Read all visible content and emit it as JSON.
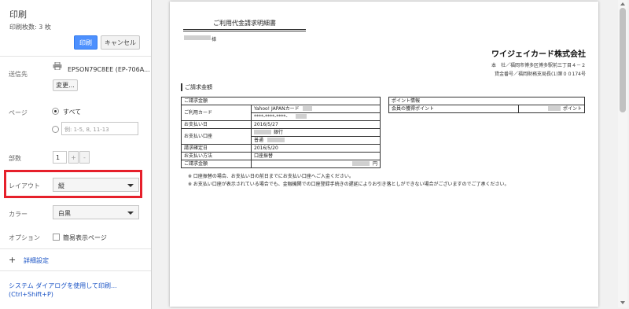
{
  "sidebar": {
    "title": "印刷",
    "sheets": "印刷枚数: 3 枚",
    "print_button": "印刷",
    "cancel_button": "キャンセル",
    "destination_label": "送信先",
    "printer_name": "EPSON79C8EE (EP-706A...",
    "change_button": "変更...",
    "pages_label": "ページ",
    "pages_all": "すべて",
    "pages_range_placeholder": "例: 1-5, 8, 11-13",
    "copies_label": "部数",
    "copies_value": "1",
    "copies_plus": "+",
    "copies_minus": "-",
    "layout_label": "レイアウト",
    "layout_value": "縦",
    "color_label": "カラー",
    "color_value": "白黒",
    "options_label": "オプション",
    "options_simplify": "簡易表示ページ",
    "advanced_plus": "+",
    "advanced": "詳細設定",
    "system_dialog": "システム ダイアログを使用して印刷...",
    "system_dialog_shortcut": "(Ctrl+Shift+P)"
  },
  "document": {
    "title": "ご利用代金請求明細書",
    "sama": "様",
    "company": "ワイジェイカード株式会社",
    "address": "本　社／福岡市博多区博多駅前三丁目４－２",
    "registration": "貸金番号／福岡財務支局長(1)第００174号",
    "section": "ご請求金額",
    "billing_table": [
      [
        "ご請求金額",
        ""
      ],
      [
        "ご利用カード",
        "Yahoo! JAPANカード"
      ],
      [
        "",
        "****-****-****-"
      ],
      [
        "お支払い日",
        "2016/5/27"
      ],
      [
        "お支払い口座",
        "銀行"
      ],
      [
        "",
        "普通"
      ],
      [
        "請求確定日",
        "2016/5/20"
      ],
      [
        "お支払い方法",
        "口座振替"
      ],
      [
        "ご請求金額",
        "円"
      ]
    ],
    "points_table": [
      [
        "ポイント情報",
        ""
      ],
      [
        "会員の獲得ポイント",
        "ポイント"
      ]
    ],
    "note1": "※ 口座振替の場合、お支払い日の前日までにお支払い口座へご入金ください。",
    "note2": "※ お支払い口座が表示されている場合でも、金融機関での口座登録手続きの遅延によりお引き落としができない場合がございますのでご了承ください。"
  }
}
